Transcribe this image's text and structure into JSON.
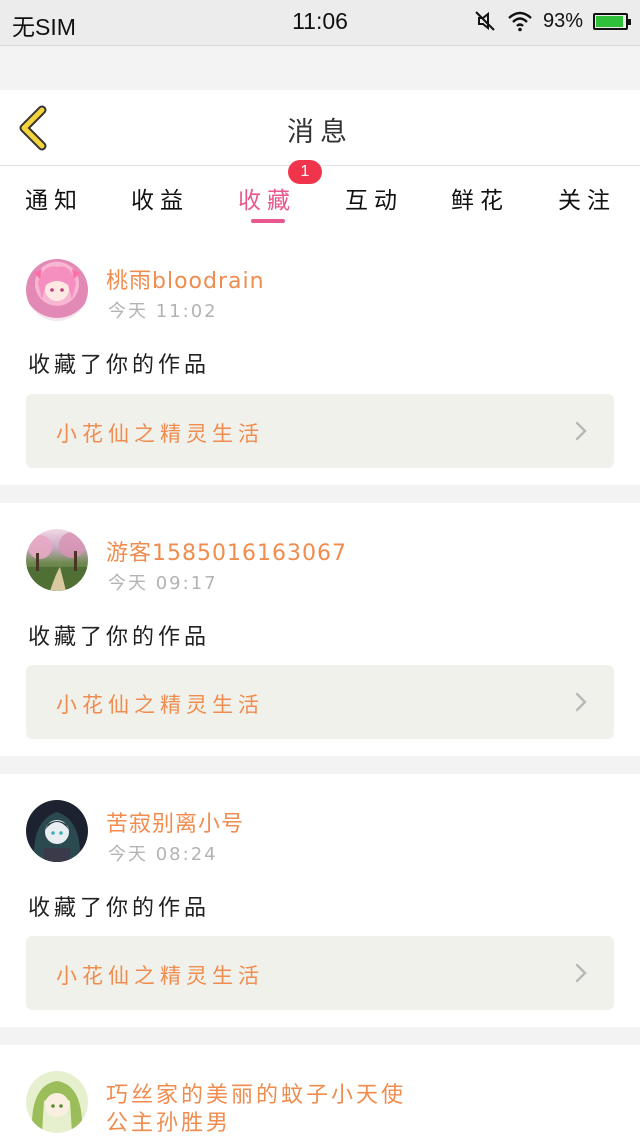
{
  "status_bar": {
    "carrier": "无SIM",
    "time": "11:06",
    "battery": "93%",
    "battery_level": 0.93,
    "icons": [
      "mute-icon",
      "wifi-icon",
      "battery-icon"
    ]
  },
  "header": {
    "back_icon": "chevron-left-icon",
    "title": "消息"
  },
  "tabs": [
    {
      "label": "通知"
    },
    {
      "label": "收益"
    },
    {
      "label": "收藏",
      "active": true,
      "badge": "1"
    },
    {
      "label": "互动"
    },
    {
      "label": "鲜花"
    },
    {
      "label": "关注"
    }
  ],
  "messages": [
    {
      "username": "桃雨bloodrain",
      "time": "今天 11:02",
      "action": "收藏了你的作品",
      "work": "小花仙之精灵生活"
    },
    {
      "username": "游客1585016163067",
      "time": "今天 09:17",
      "action": "收藏了你的作品",
      "work": "小花仙之精灵生活"
    },
    {
      "username": "苦寂别离小号",
      "time": "今天 08:24",
      "action": "收藏了你的作品",
      "work": "小花仙之精灵生活"
    },
    {
      "username_line1": "巧丝家的美丽的蚊子小天使",
      "username_line2": "公主孙胜男"
    }
  ],
  "colors": {
    "accent_pink": "#e8588e",
    "username_orange": "#f08c4e",
    "badge_red": "#f0344b",
    "back_arrow_yellow": "#f5d33a"
  }
}
